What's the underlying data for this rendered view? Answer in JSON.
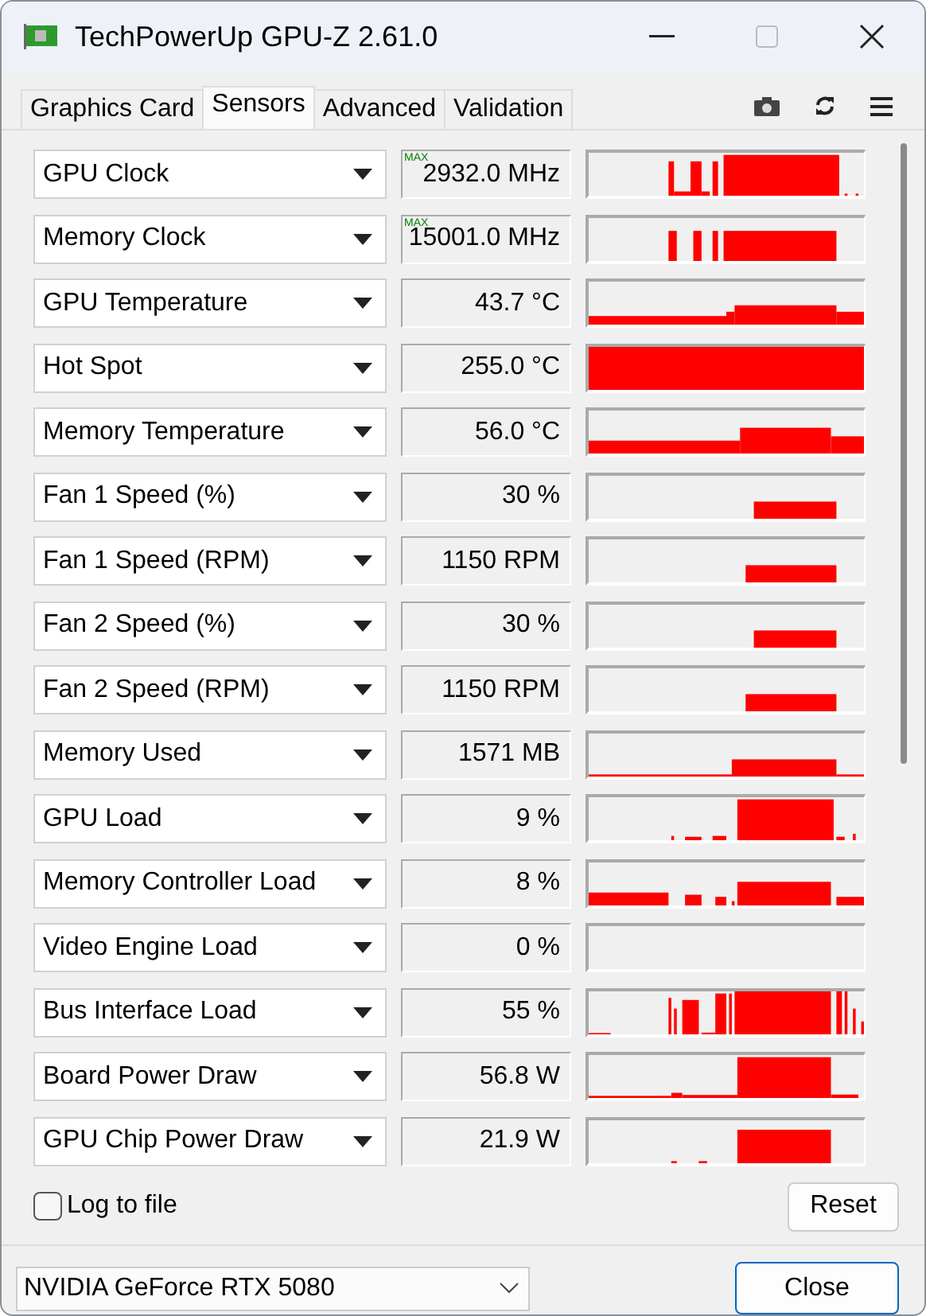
{
  "window": {
    "title": "TechPowerUp GPU-Z 2.61.0"
  },
  "tabs": [
    {
      "label": "Graphics Card",
      "selected": false
    },
    {
      "label": "Sensors",
      "selected": true
    },
    {
      "label": "Advanced",
      "selected": false
    },
    {
      "label": "Validation",
      "selected": false
    }
  ],
  "sensors": [
    {
      "name": "GPU Clock",
      "value": "2932.0 MHz",
      "badge": "MAX"
    },
    {
      "name": "Memory Clock",
      "value": "15001.0 MHz",
      "badge": "MAX"
    },
    {
      "name": "GPU Temperature",
      "value": "43.7 °C"
    },
    {
      "name": "Hot Spot",
      "value": "255.0 °C"
    },
    {
      "name": "Memory Temperature",
      "value": "56.0 °C"
    },
    {
      "name": "Fan 1 Speed (%)",
      "value": "30 %"
    },
    {
      "name": "Fan 1 Speed (RPM)",
      "value": "1150 RPM"
    },
    {
      "name": "Fan 2 Speed (%)",
      "value": "30 %"
    },
    {
      "name": "Fan 2 Speed (RPM)",
      "value": "1150 RPM"
    },
    {
      "name": "Memory Used",
      "value": "1571 MB"
    },
    {
      "name": "GPU Load",
      "value": "9 %"
    },
    {
      "name": "Memory Controller Load",
      "value": "8 %"
    },
    {
      "name": "Video Engine Load",
      "value": "0 %"
    },
    {
      "name": "Bus Interface Load",
      "value": "55 %"
    },
    {
      "name": "Board Power Draw",
      "value": "56.8 W"
    },
    {
      "name": "GPU Chip Power Draw",
      "value": "21.9 W"
    }
  ],
  "log_to_file": {
    "label": "Log to file",
    "checked": false
  },
  "reset_button": "Reset",
  "device_select": {
    "value": "NVIDIA GeForce RTX 5080"
  },
  "close_button": "Close"
}
